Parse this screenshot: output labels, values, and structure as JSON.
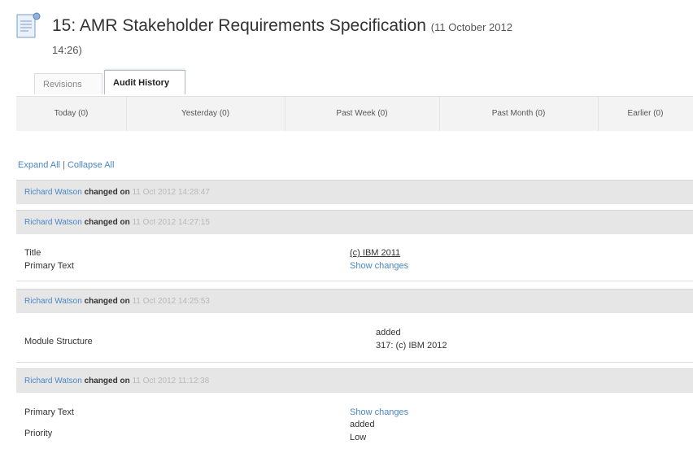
{
  "header": {
    "title": "15: AMR Stakeholder Requirements Specification",
    "date_part1": "(11 October 2012",
    "date_part2": "14:26)"
  },
  "tabs": [
    {
      "label": "Revisions"
    },
    {
      "label": "Audit History"
    }
  ],
  "periods": [
    {
      "label": "Today (0)"
    },
    {
      "label": "Yesterday (0)"
    },
    {
      "label": "Past Week (0)"
    },
    {
      "label": "Past Month (0)"
    },
    {
      "label": "Earlier (0)"
    }
  ],
  "links": {
    "expand_all": "Expand All",
    "separator": "|",
    "collapse_all": "Collapse All"
  },
  "entries": [
    {
      "user": "Richard Watson",
      "verb": "changed on",
      "date": "11 Oct 2012 14:28:47"
    },
    {
      "user": "Richard Watson",
      "verb": "changed on",
      "date": "11 Oct 2012 14:27:15",
      "fields": [
        {
          "label": "Title",
          "value": "(c) IBM 2011"
        },
        {
          "label": "Primary Text",
          "value": "Show changes"
        }
      ]
    },
    {
      "user": "Richard Watson",
      "verb": "changed on",
      "date": "11 Oct 2012 14:25:53",
      "fields": [
        {
          "label": "Module Structure",
          "value_line1": "added",
          "value_line2": "317: (c) IBM 2012"
        }
      ]
    },
    {
      "user": "Richard Watson",
      "verb": "changed on",
      "date": "11 Oct 2012 11:12:38",
      "fields": [
        {
          "label": "Primary Text",
          "value": "Show changes"
        },
        {
          "label": "Priority",
          "value_line1": "added",
          "value_line2": "Low"
        }
      ]
    }
  ]
}
